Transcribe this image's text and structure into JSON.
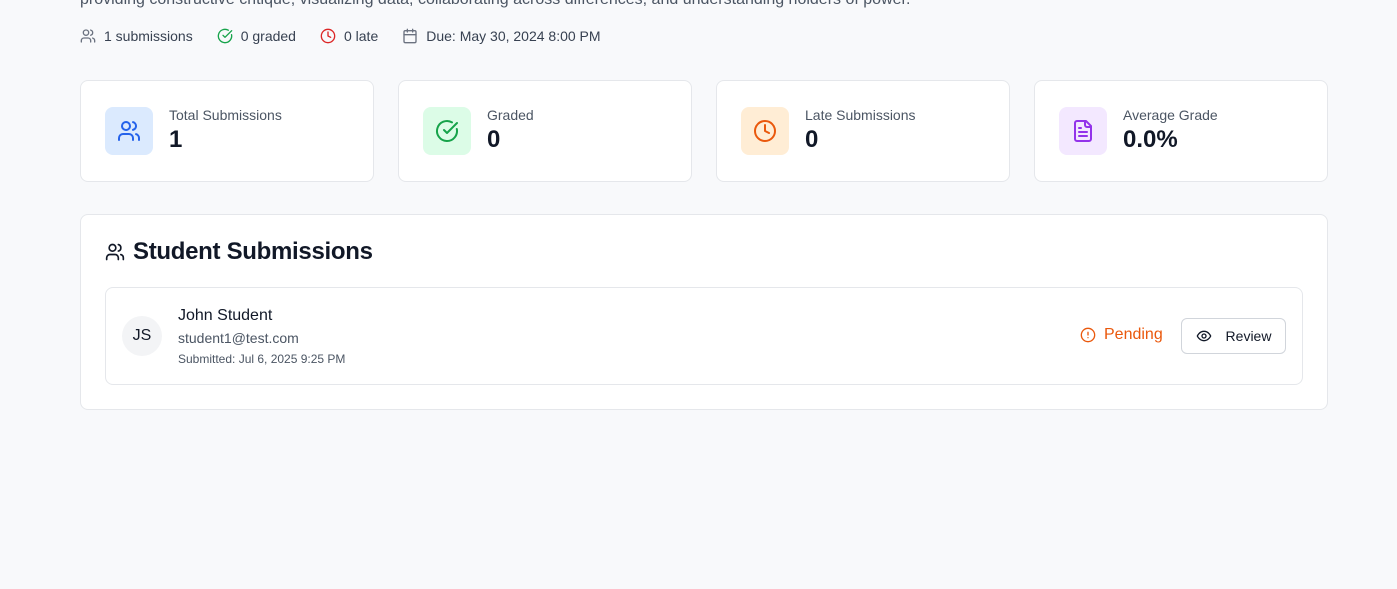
{
  "assignment": {
    "description": "providing constructive critique, visualizing data, collaborating across differences, and understanding holders of power."
  },
  "meta": {
    "submissions": "1 submissions",
    "graded": "0 graded",
    "late": "0 late",
    "due": "Due: May 30, 2024 8:00 PM"
  },
  "stats": [
    {
      "label": "Total Submissions",
      "value": "1",
      "icon": "users-icon",
      "color": "#2563eb",
      "bg": "#dbeafe"
    },
    {
      "label": "Graded",
      "value": "0",
      "icon": "check-circle-icon",
      "color": "#16a34a",
      "bg": "#dcfce7"
    },
    {
      "label": "Late Submissions",
      "value": "0",
      "icon": "clock-icon",
      "color": "#ea580c",
      "bg": "#ffedd5"
    },
    {
      "label": "Average Grade",
      "value": "0.0%",
      "icon": "file-text-icon",
      "color": "#9333ea",
      "bg": "#f3e8ff"
    }
  ],
  "submissions_panel": {
    "title": "Student Submissions",
    "rows": [
      {
        "initials": "JS",
        "name": "John Student",
        "email": "student1@test.com",
        "submitted": "Submitted: Jul 6, 2025 9:25 PM",
        "status": "Pending",
        "status_color": "#ea580c",
        "action_label": "Review"
      }
    ]
  }
}
